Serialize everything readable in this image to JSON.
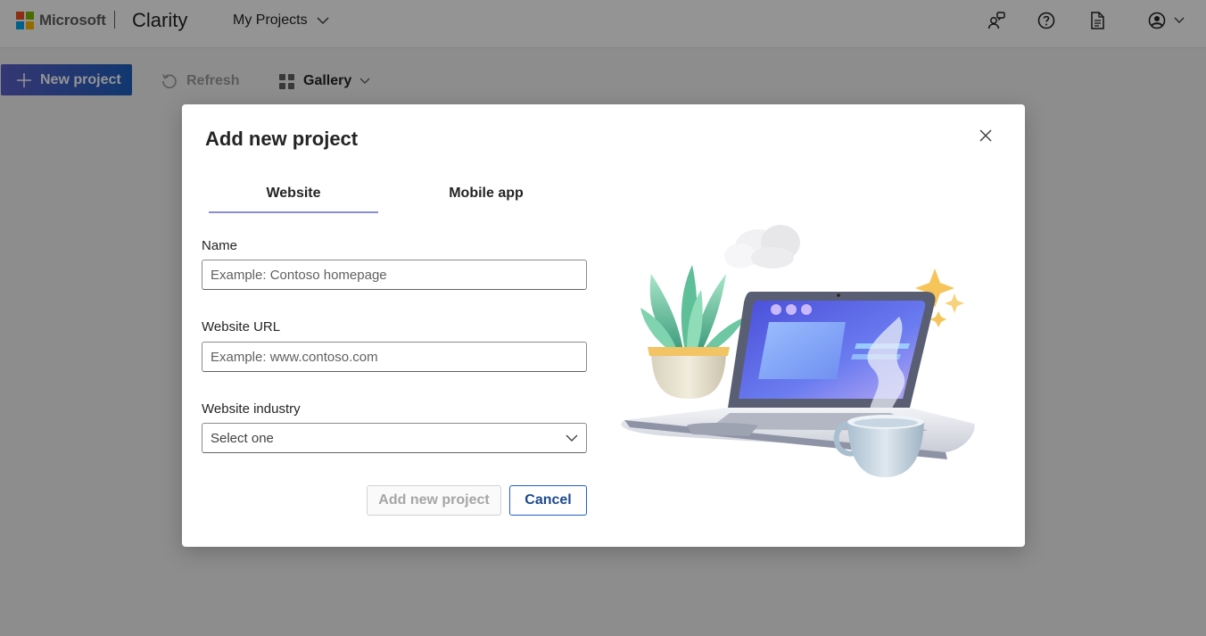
{
  "header": {
    "brand": "Microsoft",
    "product": "Clarity",
    "projects_menu": "My Projects",
    "icons": [
      "people-community-icon",
      "help-icon",
      "document-icon",
      "account-icon",
      "chevron-down-icon"
    ]
  },
  "toolbar": {
    "new_project_label": "New project",
    "refresh_label": "Refresh",
    "view_label": "Gallery"
  },
  "dialog": {
    "title": "Add new project",
    "tabs": [
      {
        "label": "Website",
        "selected": true
      },
      {
        "label": "Mobile app",
        "selected": false
      }
    ],
    "fields": {
      "name": {
        "label": "Name",
        "value": "",
        "placeholder": "Example: Contoso homepage"
      },
      "url": {
        "label": "Website URL",
        "value": "",
        "placeholder": "Example: www.contoso.com"
      },
      "industry": {
        "label": "Website industry",
        "selected": "Select one"
      }
    },
    "primary_button": "Add new project",
    "secondary_button": "Cancel"
  },
  "colors": {
    "accent": "#5b5fc7",
    "brand_blue": "#1e5fbf",
    "ms_red": "#f25022",
    "ms_green": "#7fba00",
    "ms_blue": "#00a4ef",
    "ms_yellow": "#ffb900"
  }
}
